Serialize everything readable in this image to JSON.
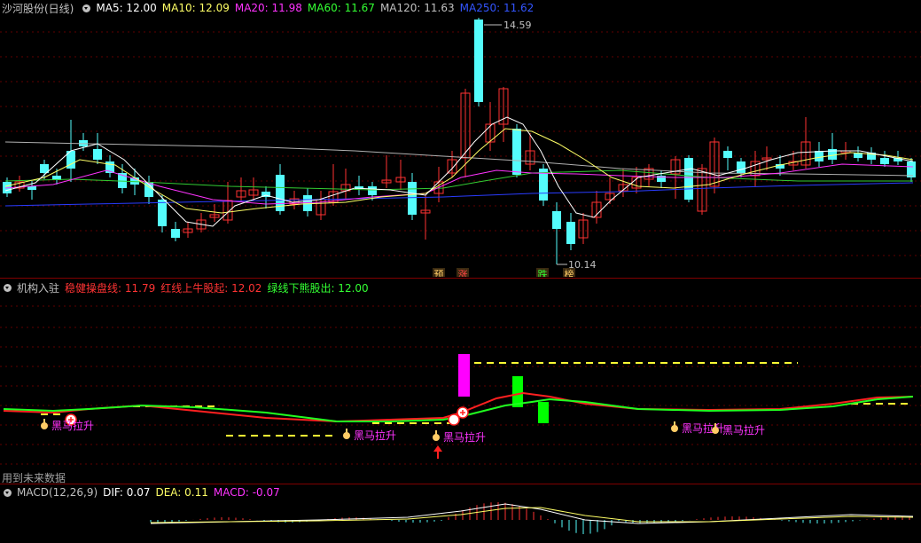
{
  "main": {
    "title": "沙河股份(日线)",
    "ma": [
      {
        "label": "MA5: 12.00",
        "color": "#ffffff"
      },
      {
        "label": "MA10: 12.09",
        "color": "#ffff66"
      },
      {
        "label": "MA20: 11.98",
        "color": "#ff33ff"
      },
      {
        "label": "MA60: 11.67",
        "color": "#33ff33"
      },
      {
        "label": "MA120: 11.63",
        "color": "#c0c0c0"
      },
      {
        "label": "MA250: 11.62",
        "color": "#3355ff"
      }
    ],
    "high_label": "14.59",
    "low_label": "10.14",
    "tags": [
      {
        "text": "预",
        "color": "#ffcc66"
      },
      {
        "text": "涨",
        "color": "#ff4444"
      },
      {
        "text": "跌",
        "color": "#33ff33"
      },
      {
        "text": "榜",
        "color": "#ffcc66"
      }
    ]
  },
  "indicator": {
    "title": "机构入驻",
    "items": [
      {
        "label": "稳健操盘线: 11.79",
        "color": "#ff3333"
      },
      {
        "label": "红线上牛股起: 12.02",
        "color": "#ff3333"
      },
      {
        "label": "绿线下熊股出: 12.00",
        "color": "#33ff33"
      }
    ],
    "signal_label": "黑马拉升"
  },
  "note": "用到未来数据",
  "macd": {
    "title": "MACD(12,26,9)",
    "dif": "DIF: 0.07",
    "dea": "DEA: 0.11",
    "macd": "MACD: -0.07"
  },
  "colors": {
    "up": "#ff3232",
    "down": "#54fcfc",
    "separator": "#800000",
    "grid": "#600000"
  }
}
